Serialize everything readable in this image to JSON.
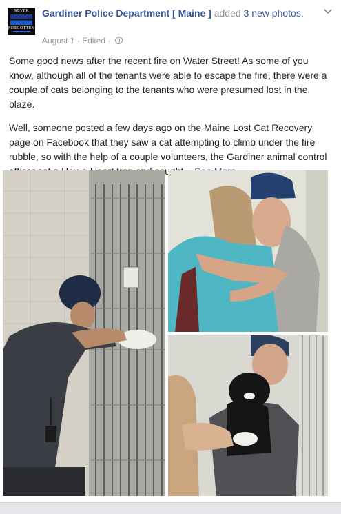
{
  "post": {
    "page_name": "Gardiner Police Department [ Maine ]",
    "action_text": "added",
    "count_link": "3 new photos.",
    "date": "August 1",
    "separator": "·",
    "edited": "Edited",
    "separator2": "·",
    "paragraph1": "Some good news after the recent fire on Water Street! As some of you know, although all of the tenants were able to escape the fire, there were a couple of cats belonging to the tenants who were presumed lost in the blaze.",
    "paragraph2": "Well, someone posted a few days ago on the Maine Lost Cat Recovery page on Facebook that they saw a cat attempting to climb under the fire rubble, so with the help of a couple volunteers, the Gardiner animal control officer set a Hav-a-Heart trap and caught...",
    "see_more": "See More"
  },
  "avatar": {
    "top_text": "NEVER",
    "bottom_text": "FORGOTTEN"
  },
  "icons": {
    "privacy": "globe-icon",
    "options": "chevron-down-icon"
  },
  "colors": {
    "link": "#365899",
    "meta": "#90949c",
    "text": "#1d2129",
    "background": "#e9ebee"
  }
}
